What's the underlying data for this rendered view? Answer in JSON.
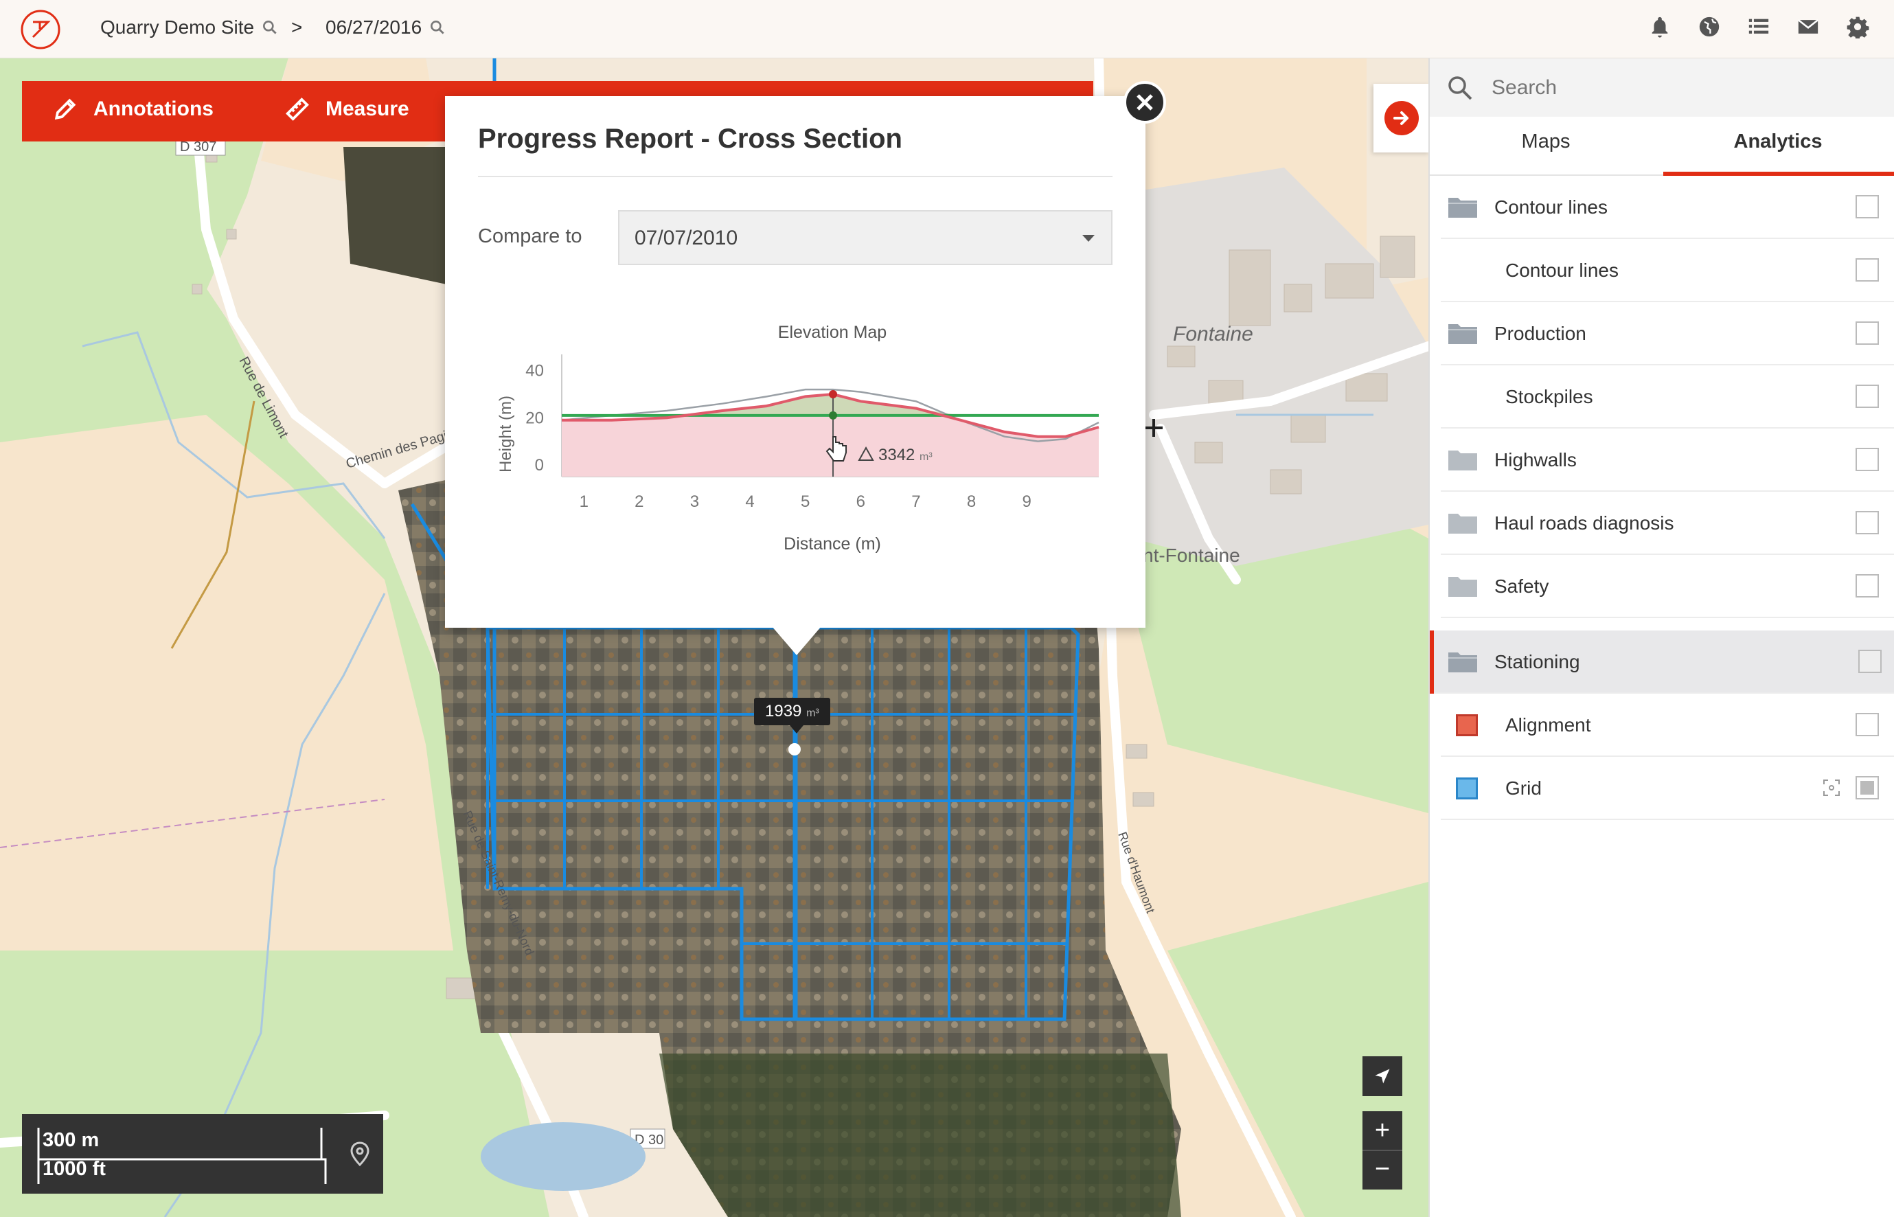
{
  "breadcrumb": {
    "site": "Quarry Demo Site",
    "separator": ">",
    "date": "06/27/2016"
  },
  "header_icons": [
    "bell-icon",
    "globe-icon",
    "list-icon",
    "mail-icon",
    "gear-icon"
  ],
  "toolbar": {
    "annotations_label": "Annotations",
    "measure_label": "Measure"
  },
  "popup": {
    "title": "Progress Report - Cross Section",
    "compare_label": "Compare to",
    "compare_value": "07/07/2010"
  },
  "chart_data": {
    "type": "line",
    "title": "Elevation Map",
    "xlabel": "Distance (m)",
    "ylabel": "Height (m)",
    "x_ticks": [
      "1",
      "2",
      "3",
      "4",
      "5",
      "6",
      "7",
      "8",
      "9"
    ],
    "y_ticks": [
      "0",
      "20",
      "40"
    ],
    "xlim": [
      0.6,
      10.3
    ],
    "ylim": [
      -5,
      44
    ],
    "series": [
      {
        "color": "#9aa0a6",
        "x": [
          0.6,
          1.5,
          2.5,
          3.5,
          4.3,
          5.0,
          5.5,
          6.0,
          7.0,
          7.8,
          8.6,
          9.2,
          9.7,
          10.3
        ],
        "y": [
          19,
          21,
          23,
          26,
          29,
          32,
          32,
          31,
          27,
          19,
          12,
          10,
          11,
          18
        ]
      },
      {
        "color": "#e05a6a",
        "x": [
          0.6,
          1.5,
          2.5,
          3.5,
          4.3,
          5.0,
          5.5,
          6.0,
          7.0,
          7.8,
          8.6,
          9.2,
          9.7,
          10.3
        ],
        "y": [
          19,
          19,
          20,
          23,
          25,
          29,
          30,
          27,
          24,
          19,
          14,
          12,
          12,
          16
        ]
      },
      {
        "color": "#34a853",
        "x": [
          0.6,
          10.3
        ],
        "y": [
          21,
          21
        ]
      }
    ],
    "marker_x": 5.5,
    "annotation": "3342",
    "annotation_unit": "m³"
  },
  "map": {
    "volume_tip_value": "1939",
    "volume_tip_unit": "m³",
    "labels": [
      "D 307",
      "Rue de Limont",
      "Chemin des Pagi",
      "Fontaine",
      "nt-Fontaine",
      "Rue de Saint-Remy-du-Nord",
      "Rue d'Haumont",
      "D 30"
    ]
  },
  "scale": {
    "metric": "300 m",
    "imperial": "1000 ft"
  },
  "map_controls": {
    "zoom_in": "+",
    "zoom_out": "−"
  },
  "sidebar": {
    "search_placeholder": "Search",
    "tabs": [
      "Maps",
      "Analytics"
    ],
    "active_tab": "Analytics",
    "layers": [
      {
        "label": "Contour lines",
        "type": "folder",
        "checked": false
      },
      {
        "label": "Contour lines",
        "type": "child",
        "checked": false
      },
      {
        "label": "Production",
        "type": "folder",
        "checked": false
      },
      {
        "label": "Stockpiles",
        "type": "child",
        "checked": false
      },
      {
        "label": "Highwalls",
        "type": "folder",
        "checked": false
      },
      {
        "label": "Haul roads diagnosis",
        "type": "folder",
        "checked": false
      },
      {
        "label": "Safety",
        "type": "folder",
        "checked": false
      },
      {
        "label": "Stationing",
        "type": "folder",
        "checked": false,
        "active": true
      },
      {
        "label": "Alignment",
        "type": "swatch",
        "swatch_color": "#e8654e",
        "checked": false
      },
      {
        "label": "Grid",
        "type": "swatch",
        "swatch_color": "#6ab8ea",
        "checked": true
      }
    ]
  },
  "colors": {
    "accent": "#e12d14",
    "grid_blue": "#1a8be0",
    "map_green": "#cfe8b6",
    "map_beige": "#f7e5cc"
  }
}
